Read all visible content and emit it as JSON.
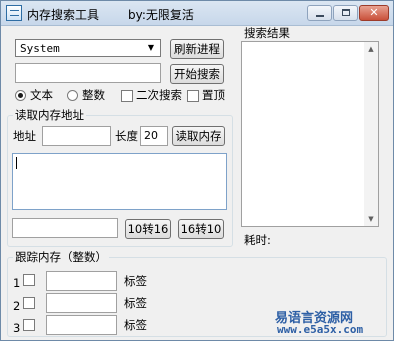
{
  "window": {
    "title": "内存搜索工具",
    "subtitle": "by:无限复活",
    "close_glyph": "✕"
  },
  "search": {
    "type_value": "System",
    "refresh_label": "刷新进程",
    "start_label": "开始搜索",
    "query_value": "",
    "radio_text": "文本",
    "radio_int": "整数",
    "radio_selected": "text",
    "check_second": "二次搜索",
    "check_top": "置顶"
  },
  "read": {
    "group_title": "读取内存地址",
    "address_label": "地址",
    "address_value": "",
    "length_label": "长度",
    "length_value": "20",
    "read_label": "读取内存",
    "hex_value": "",
    "btn_10to16": "10转16",
    "btn_16to10": "16转10"
  },
  "results": {
    "title": "搜索结果",
    "elapsed_label": "耗时:"
  },
  "track": {
    "title": "跟踪内存（整数）",
    "rows": [
      {
        "num": "1",
        "value": "",
        "tag": "标签"
      },
      {
        "num": "2",
        "value": "",
        "tag": "标签"
      },
      {
        "num": "3",
        "value": "",
        "tag": "标签"
      }
    ]
  },
  "watermark": {
    "line1": "易语言资源网",
    "line2": "www.e5a5x.com"
  }
}
